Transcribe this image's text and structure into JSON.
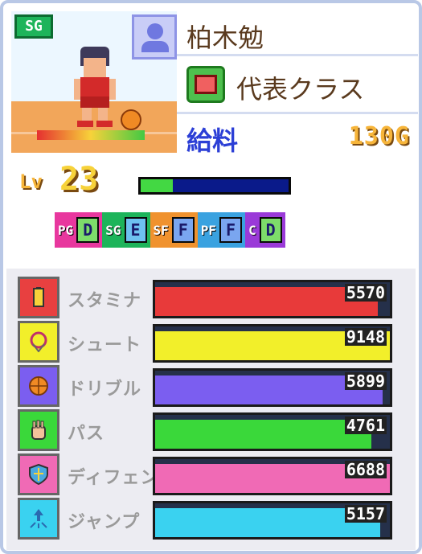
{
  "player": {
    "position_badge": "SG",
    "name": "柏木勉",
    "class": "代表クラス",
    "salary_label": "給料",
    "salary_value": "130G",
    "level_label": "Lv",
    "level": "23",
    "exp_fraction": 0.22
  },
  "grades": [
    {
      "pos": "PG",
      "rank": "D",
      "color": "#e8379e",
      "rank_bg": "#7ddc6a"
    },
    {
      "pos": "SG",
      "rank": "E",
      "color": "#1db45a",
      "rank_bg": "#6ec1f0"
    },
    {
      "pos": "SF",
      "rank": "F",
      "color": "#f0922e",
      "rank_bg": "#7aa6f0"
    },
    {
      "pos": "PF",
      "rank": "F",
      "color": "#3aa2e0",
      "rank_bg": "#7aa6f0"
    },
    {
      "pos": "C",
      "rank": "D",
      "color": "#9a3ad8",
      "rank_bg": "#7ddc6a"
    }
  ],
  "stats": [
    {
      "name": "スタミナ",
      "value": "5570",
      "fraction": 0.95,
      "bar_color": "#e83a3a",
      "icon_bg": "#e84040",
      "icon": "battery-icon"
    },
    {
      "name": "シュート",
      "value": "9148",
      "fraction": 1.0,
      "bar_color": "#f2ef2a",
      "icon_bg": "#f2ef2a",
      "icon": "hoop-icon"
    },
    {
      "name": "ドリブル",
      "value": "5899",
      "fraction": 0.97,
      "bar_color": "#7b5ef0",
      "icon_bg": "#7b5ef0",
      "icon": "basketball-icon"
    },
    {
      "name": "パス",
      "value": "4761",
      "fraction": 0.92,
      "bar_color": "#3ad83a",
      "icon_bg": "#3ad83a",
      "icon": "hand-icon"
    },
    {
      "name": "ディフェンス",
      "value": "6688",
      "fraction": 1.0,
      "bar_color": "#f06ab5",
      "icon_bg": "#f06ab5",
      "icon": "shield-icon"
    },
    {
      "name": "ジャンプ",
      "value": "5157",
      "fraction": 0.96,
      "bar_color": "#3ad2f0",
      "icon_bg": "#3ad2f0",
      "icon": "jump-icon"
    }
  ]
}
